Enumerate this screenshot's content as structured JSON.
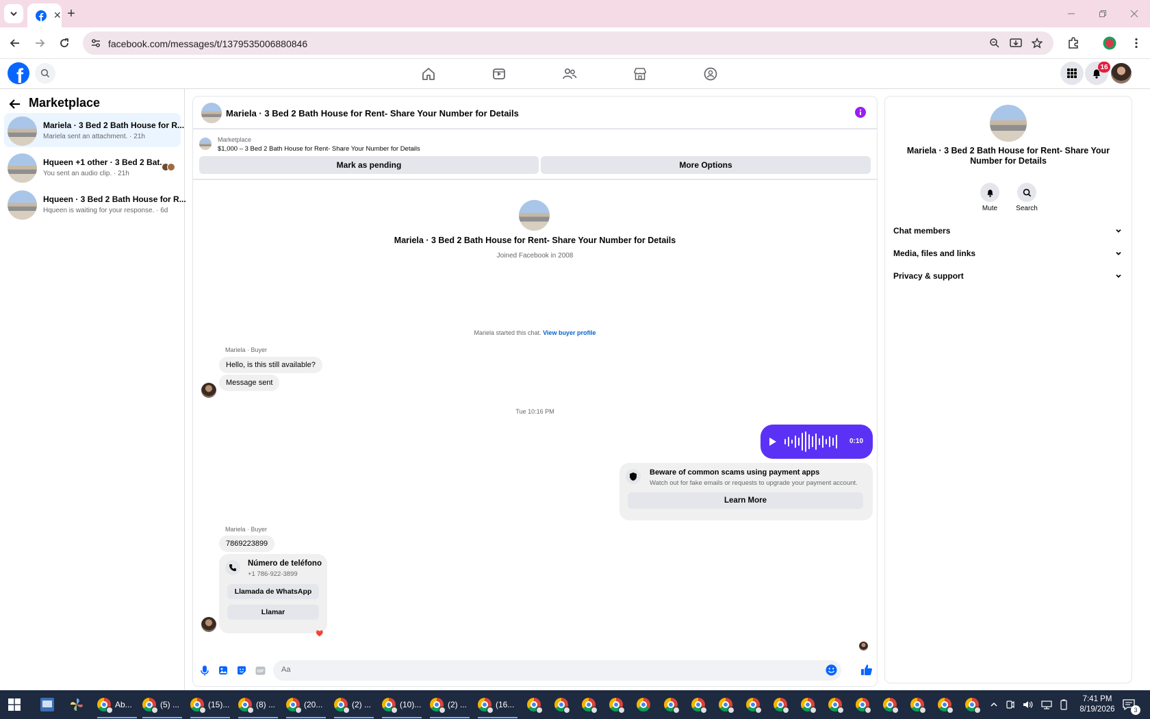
{
  "browser": {
    "url": "facebook.com/messages/t/1379535006880846"
  },
  "fb_header": {
    "notification_count": "16"
  },
  "sidebar": {
    "title": "Marketplace",
    "conversations": [
      {
        "title": "Mariela · 3 Bed 2 Bath House for R...",
        "subtitle": "Mariela sent an attachment. · 21h"
      },
      {
        "title": "Hqueen +1 other · 3 Bed 2 Bat...",
        "subtitle": "You sent an audio clip. · 21h"
      },
      {
        "title": "Hqueen · 3 Bed 2 Bath House for R...",
        "subtitle": "Hqueen is waiting for your response. · 6d"
      }
    ]
  },
  "chat": {
    "header_title": "Mariela · 3 Bed 2 Bath House for Rent- Share Your Number for Details",
    "listing_source": "Marketplace",
    "listing_line": "$1,000 – 3 Bed 2 Bath House for Rent- Share Your Number for Details",
    "mark_pending_label": "Mark as pending",
    "more_options_label": "More Options",
    "intro_title": "Mariela · 3 Bed 2 Bath House for Rent- Share Your Number for Details",
    "intro_sub": "Joined Facebook in 2008",
    "started_text": "Mariela started this chat.",
    "view_profile_label": "View buyer profile",
    "sender_label_1": "Mariela · Buyer",
    "msg_1": "Hello, is this still available?",
    "msg_2": "Message sent",
    "timestamp": "Tue 10:16 PM",
    "audio_duration": "0:10",
    "scam_title": "Beware of common scams using payment apps",
    "scam_text": "Watch out for fake emails or requests to upgrade your payment account.",
    "learn_more_label": "Learn More",
    "sender_label_2": "Mariela · Buyer",
    "msg_3": "7869223899",
    "phone_title": "Número de teléfono",
    "phone_number": "+1 786-922-3899",
    "whatsapp_label": "Llamada de WhatsApp",
    "call_label": "Llamar",
    "reaction": "❤️",
    "composer_placeholder": "Aa"
  },
  "info_panel": {
    "title": "Mariela · 3 Bed 2 Bath House for Rent- Share Your Number for Details",
    "mute_label": "Mute",
    "search_label": "Search",
    "sections": [
      "Chat members",
      "Media, files and links",
      "Privacy & support"
    ]
  },
  "taskbar": {
    "labeled_items": [
      "Ab...",
      "(5) ...",
      "(15)...",
      "(8) ...",
      "(20...",
      "(2) ...",
      "(10)...",
      "(2) ...",
      "(16..."
    ],
    "time": "7:41 PM",
    "date": "8/19/2026",
    "notification_count": "3"
  },
  "colors": {
    "fb_blue": "#0866ff",
    "messenger_purple": "#5b32f5",
    "tab_strip": "#f4dbe6"
  }
}
